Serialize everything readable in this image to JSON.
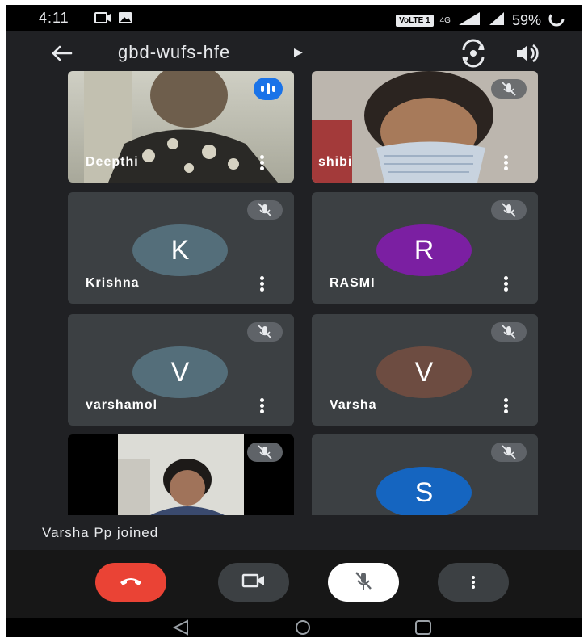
{
  "status_bar": {
    "time": "4:11",
    "network": "VoLTE 1",
    "network_gen": "4G",
    "battery": "59%"
  },
  "header": {
    "meeting_code": "gbd-wufs-hfe",
    "icons": [
      "back-arrow-icon",
      "camera-flip-icon",
      "speaker-icon"
    ]
  },
  "participants": [
    {
      "name": "Deepthi",
      "type": "video",
      "speaking": true
    },
    {
      "name": "shibi",
      "type": "video",
      "muted": true
    },
    {
      "name": "Krishna",
      "initial": "K",
      "color": "#546e7a",
      "muted": true
    },
    {
      "name": "RASMI",
      "initial": "R",
      "color": "#7b1fa2",
      "muted": true
    },
    {
      "name": "varshamol",
      "initial": "V",
      "color": "#546e7a",
      "muted": true
    },
    {
      "name": "Varsha",
      "initial": "V",
      "color": "#6d4c41",
      "muted": true
    },
    {
      "name": "",
      "type": "video",
      "muted": true
    },
    {
      "name": "",
      "initial": "S",
      "color": "#1565c0",
      "muted": true
    }
  ],
  "notification": {
    "text": "Varsha Pp joined"
  },
  "controls": {
    "end_call_color": "#ea4335",
    "icons": [
      "end-call-icon",
      "camera-icon",
      "mic-off-icon",
      "more-options-icon"
    ]
  },
  "colors": {
    "background": "#202124",
    "tile": "#3c4043",
    "mute_badge": "#5f6368"
  }
}
